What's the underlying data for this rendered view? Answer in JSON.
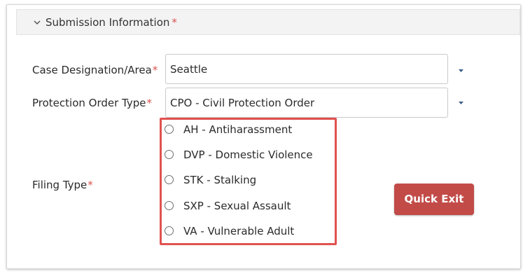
{
  "section": {
    "title": "Submission Information",
    "required_mark": "*"
  },
  "fields": {
    "case_designation": {
      "label": "Case Designation/Area",
      "required_mark": "*",
      "value": "Seattle"
    },
    "protection_order_type": {
      "label": "Protection Order Type",
      "required_mark": "*",
      "value": "CPO - Civil Protection Order"
    },
    "filing_type": {
      "label": "Filing Type",
      "required_mark": "*",
      "options": [
        {
          "label": "AH - Antiharassment"
        },
        {
          "label": "DVP - Domestic Violence"
        },
        {
          "label": "STK - Stalking"
        },
        {
          "label": "SXP - Sexual Assault"
        },
        {
          "label": "VA - Vulnerable Adult"
        }
      ]
    }
  },
  "buttons": {
    "quick_exit": "Quick Exit"
  },
  "icons": {
    "collapse": "chevron-down-icon",
    "dropdown": "caret-down-icon"
  },
  "colors": {
    "required": "#d9534f",
    "highlight_border": "#e0524f",
    "quick_exit_bg": "#c24b48",
    "dropdown_arrow": "#3b5b8a"
  }
}
